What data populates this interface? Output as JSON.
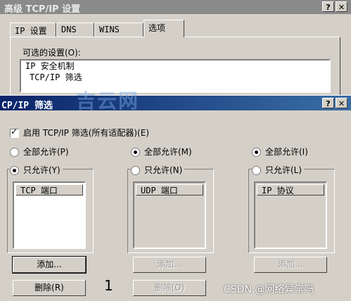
{
  "back_window": {
    "title": "高级 TCP/IP 设置",
    "tabs": [
      "IP 设置",
      "DNS",
      "WINS",
      "选项"
    ],
    "options_label": "可选的设置(O):",
    "options": [
      "IP 安全机制",
      "TCP/IP 筛选"
    ]
  },
  "dialog": {
    "title": "CP/IP 筛选",
    "watermark": "吉云网",
    "help_button": "?",
    "close_button": "✕",
    "enable_label": "启用 TCP/IP 筛选(所有适配器)(E)",
    "tcp": {
      "allow_all": "全部允许(P)",
      "allow_only": "只允许(Y)",
      "header": "TCP 端口",
      "add": "添加...",
      "remove": "删除(R)"
    },
    "udp": {
      "allow_all": "全部允许(M)",
      "allow_only": "只允许(N)",
      "header": "UDP 端口",
      "add": "添加...",
      "remove": "删除(O)"
    },
    "ip": {
      "allow_all": "全部允许(I)",
      "allow_only": "只允许(L)",
      "header": "IP 协议",
      "add": "添加..."
    },
    "annotation": "1",
    "csdn_watermark": "CSDN @网络异常吗"
  },
  "colors": {
    "dialog_face": "#d4d0c8",
    "active_title": "#0a246a",
    "inactive_title": "#8a8a8a"
  }
}
